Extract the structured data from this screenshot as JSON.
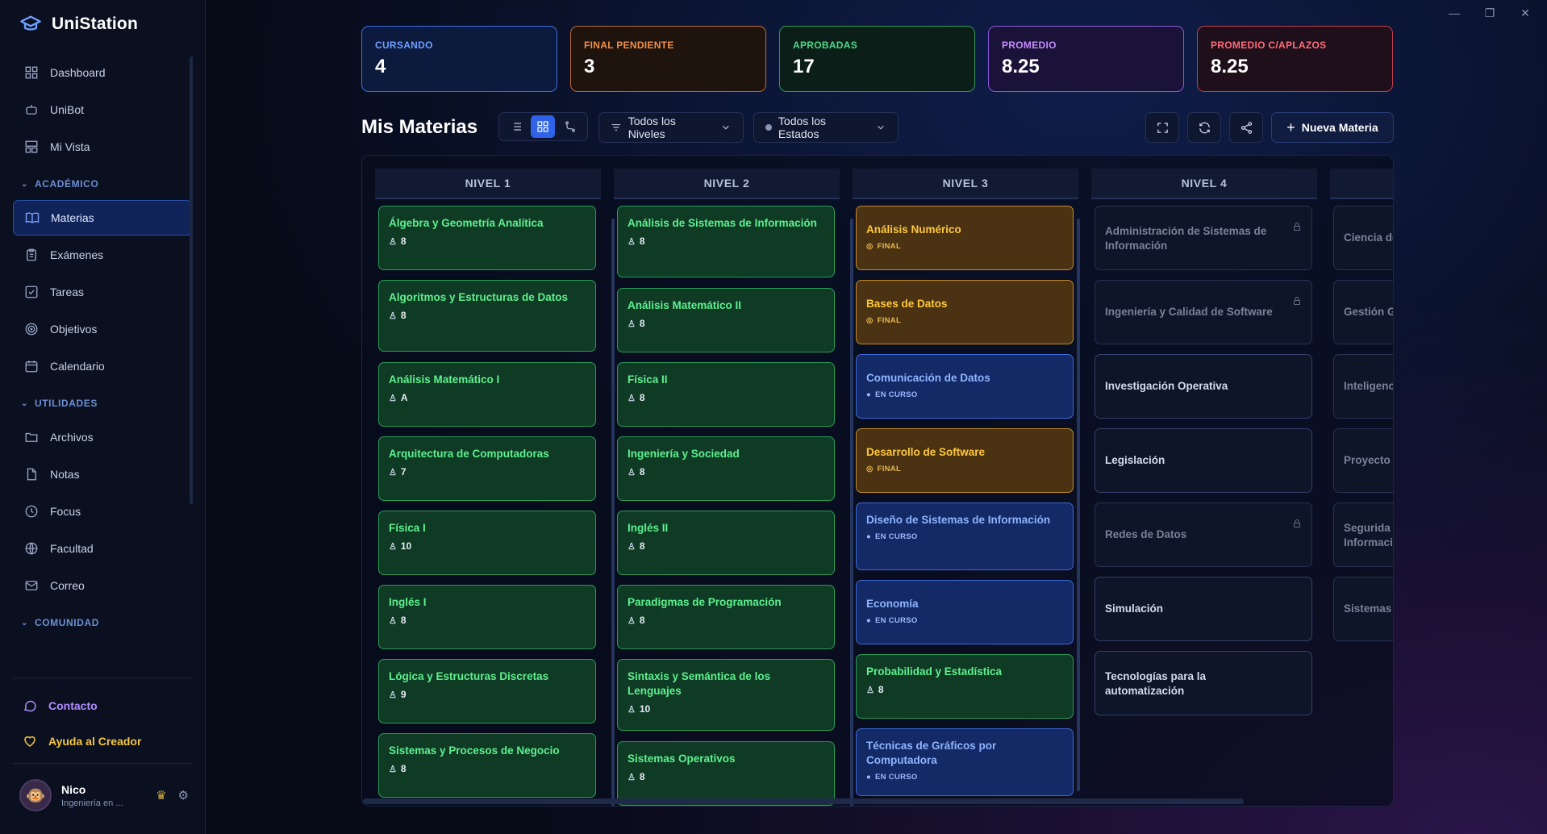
{
  "app": {
    "name": "UniStation"
  },
  "sidebar": {
    "top_items": [
      {
        "label": "Dashboard",
        "icon": "dashboard-icon"
      },
      {
        "label": "UniBot",
        "icon": "bot-icon"
      },
      {
        "label": "Mi Vista",
        "icon": "layout-icon"
      }
    ],
    "academic": {
      "title": "ACADÉMICO",
      "items": [
        {
          "label": "Materias",
          "icon": "book-icon",
          "active": true
        },
        {
          "label": "Exámenes",
          "icon": "clipboard-icon"
        },
        {
          "label": "Tareas",
          "icon": "checkbox-icon"
        },
        {
          "label": "Objetivos",
          "icon": "target-icon"
        },
        {
          "label": "Calendario",
          "icon": "calendar-icon"
        }
      ]
    },
    "utilities": {
      "title": "UTILIDADES",
      "items": [
        {
          "label": "Archivos",
          "icon": "folder-icon"
        },
        {
          "label": "Notas",
          "icon": "file-icon"
        },
        {
          "label": "Focus",
          "icon": "clock-icon"
        },
        {
          "label": "Facultad",
          "icon": "globe-icon"
        },
        {
          "label": "Correo",
          "icon": "mail-icon"
        }
      ]
    },
    "community": {
      "title": "COMUNIDAD"
    },
    "contact": "Contacto",
    "help": "Ayuda al Creador",
    "user": {
      "name": "Nico",
      "subtitle": "Ingeniería en ..."
    }
  },
  "stats": [
    {
      "label": "CURSANDO",
      "value": "4"
    },
    {
      "label": "FINAL PENDIENTE",
      "value": "3"
    },
    {
      "label": "APROBADAS",
      "value": "17"
    },
    {
      "label": "PROMEDIO",
      "value": "8.25"
    },
    {
      "label": "PROMEDIO C/APLAZOS",
      "value": "8.25"
    }
  ],
  "toolbar": {
    "title": "Mis Materias",
    "level_filter": "Todos los Niveles",
    "state_filter": "Todos los Estados",
    "new_button": "Nueva Materia"
  },
  "board": {
    "columns": [
      {
        "title": "NIVEL 1",
        "cards": [
          {
            "name": "Álgebra y Geometría Analítica",
            "grade": "8"
          },
          {
            "name": "Algoritmos y Estructuras de Datos",
            "grade": "8"
          },
          {
            "name": "Análisis Matemático I",
            "grade": "A"
          },
          {
            "name": "Arquitectura de Computadoras",
            "grade": "7"
          },
          {
            "name": "Física I",
            "grade": "10"
          },
          {
            "name": "Inglés I",
            "grade": "8"
          },
          {
            "name": "Lógica y Estructuras Discretas",
            "grade": "9"
          },
          {
            "name": "Sistemas y Procesos de Negocio",
            "grade": "8"
          }
        ]
      },
      {
        "title": "NIVEL 2",
        "cards": [
          {
            "name": "Análisis de Sistemas de Información",
            "grade": "8"
          },
          {
            "name": "Análisis Matemático II",
            "grade": "8"
          },
          {
            "name": "Física II",
            "grade": "8"
          },
          {
            "name": "Ingeniería y Sociedad",
            "grade": "8"
          },
          {
            "name": "Inglés II",
            "grade": "8"
          },
          {
            "name": "Paradigmas de Programación",
            "grade": "8"
          },
          {
            "name": "Sintaxis y Semántica de los Lenguajes",
            "grade": "10"
          },
          {
            "name": "Sistemas Operativos",
            "grade": "8"
          }
        ]
      },
      {
        "title": "NIVEL 3",
        "cards": [
          {
            "name": "Análisis Numérico",
            "status": "FINAL"
          },
          {
            "name": "Bases de Datos",
            "status": "FINAL"
          },
          {
            "name": "Comunicación de Datos",
            "status": "EN CURSO"
          },
          {
            "name": "Desarrollo de Software",
            "status": "FINAL"
          },
          {
            "name": "Diseño de Sistemas de Información",
            "status": "EN CURSO"
          },
          {
            "name": "Economía",
            "status": "EN CURSO"
          },
          {
            "name": "Probabilidad y Estadística",
            "grade": "8"
          },
          {
            "name": "Técnicas de Gráficos por Computadora",
            "status": "EN CURSO"
          }
        ]
      },
      {
        "title": "NIVEL 4",
        "cards": [
          {
            "name": "Administración de Sistemas de Información"
          },
          {
            "name": "Ingeniería y Calidad de Software"
          },
          {
            "name": "Investigación Operativa"
          },
          {
            "name": "Legislación"
          },
          {
            "name": "Redes de Datos"
          },
          {
            "name": "Simulación"
          },
          {
            "name": "Tecnologías para la automatización"
          }
        ]
      },
      {
        "title": "",
        "cards": [
          {
            "name": "Ciencia de"
          },
          {
            "name": "Gestión G"
          },
          {
            "name": "Inteligenc"
          },
          {
            "name": "Proyecto"
          },
          {
            "name": "Segurida Informaci"
          },
          {
            "name": "Sistemas"
          }
        ]
      }
    ]
  }
}
